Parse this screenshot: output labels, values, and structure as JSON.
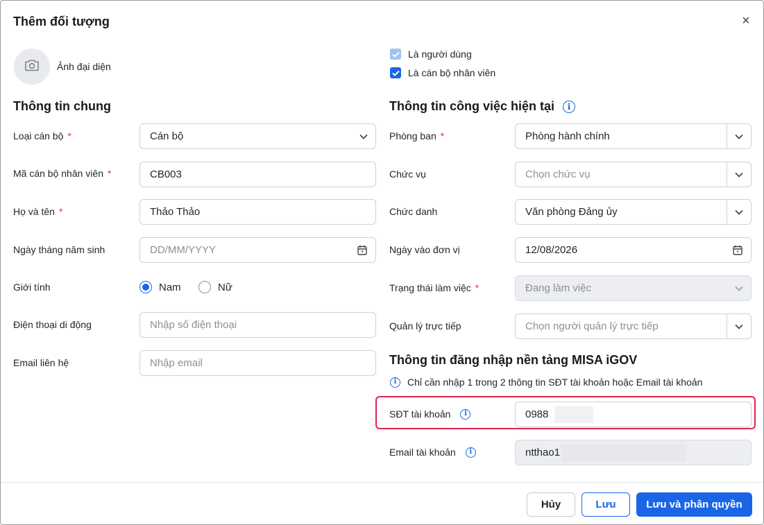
{
  "dialog": {
    "title": "Thêm đối tượng",
    "close_symbol": "×"
  },
  "avatar": {
    "label": "Ảnh đại diện",
    "icon": "camera-icon"
  },
  "checkboxes": [
    {
      "label": "Là người dùng",
      "checked": true,
      "disabled": true
    },
    {
      "label": "Là cán bộ nhân viên",
      "checked": true,
      "disabled": false
    }
  ],
  "general": {
    "title": "Thông tin chung",
    "staff_type": {
      "label": "Loại cán bộ",
      "required": "*",
      "value": "Cán bộ"
    },
    "staff_code": {
      "label": "Mã cán bộ nhân viên",
      "required": "*",
      "value": "CB003"
    },
    "full_name": {
      "label": "Họ và tên",
      "required": "*",
      "value": "Thảo Thảo"
    },
    "dob": {
      "label": "Ngày tháng năm sinh",
      "placeholder": "DD/MM/YYYY"
    },
    "gender": {
      "label": "Giới tính",
      "options": [
        "Nam",
        "Nữ"
      ],
      "selected": "Nam"
    },
    "phone": {
      "label": "Điện thoại di động",
      "placeholder": "Nhập số điện thoại"
    },
    "email": {
      "label": "Email liên hệ",
      "placeholder": "Nhập email"
    }
  },
  "job": {
    "title": "Thông tin công việc hiện tại",
    "department": {
      "label": "Phòng ban",
      "required": "*",
      "value": "Phòng hành chính"
    },
    "position": {
      "label": "Chức vụ",
      "placeholder": "Chọn chức vụ"
    },
    "job_title": {
      "label": "Chức danh",
      "value": "Văn phòng Đảng ủy"
    },
    "join_date": {
      "label": "Ngày vào đơn vị",
      "value": "12/08/2026"
    },
    "work_status": {
      "label": "Trạng thái làm việc",
      "required": "*",
      "value": "Đang làm việc"
    },
    "manager": {
      "label": "Quản lý trực tiếp",
      "placeholder": "Chọn người quản lý trực tiếp"
    }
  },
  "login": {
    "title": "Thông tin đăng nhập nền tảng MISA iGOV",
    "hint": "Chỉ cần nhập 1 trong 2 thông tin SĐT tài khoản hoặc Email tài khoản",
    "phone": {
      "label": "SĐT tài khoản",
      "value": "0988"
    },
    "email": {
      "label": "Email tài khoản",
      "value": "ntthao1"
    }
  },
  "footer": {
    "cancel": "Hủy",
    "save": "Lưu",
    "save_assign": "Lưu và phân quyền"
  },
  "colors": {
    "primary": "#1a64e8",
    "required": "#e0313f",
    "highlight": "#e0234f"
  }
}
